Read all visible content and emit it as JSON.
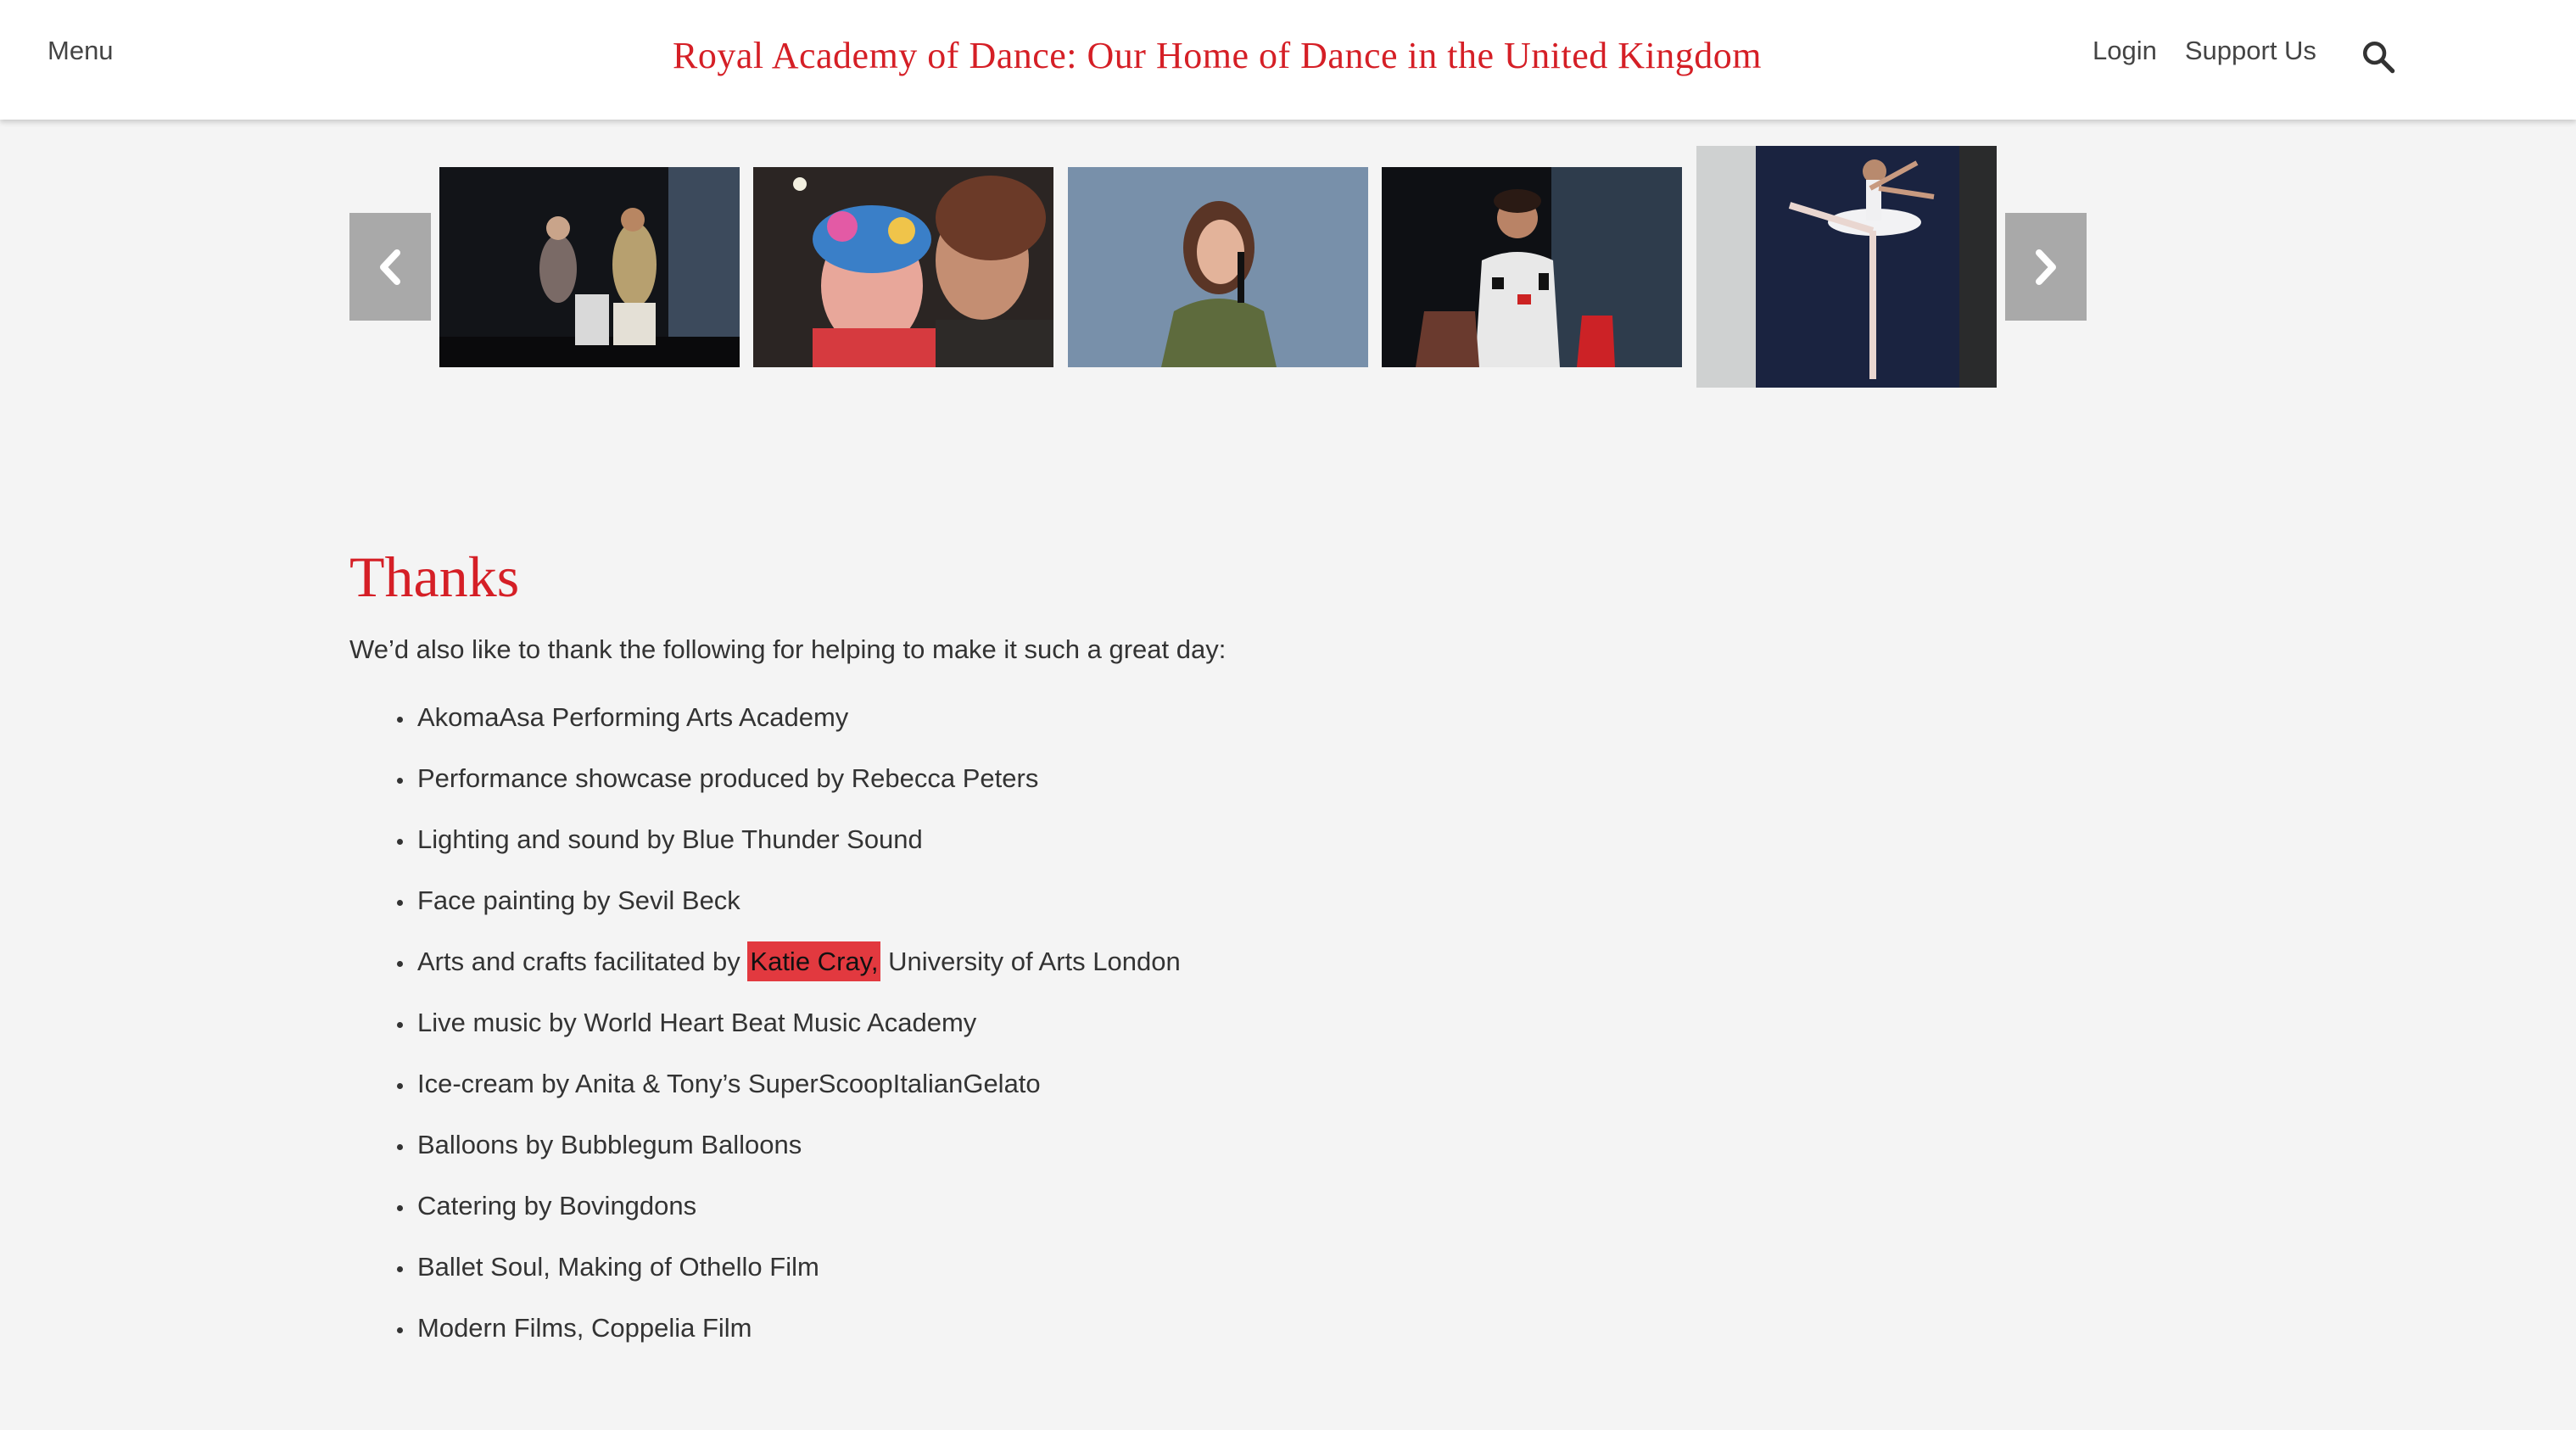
{
  "header": {
    "menu_label": "Menu",
    "title": "Royal Academy of Dance: Our Home of Dance in the United Kingdom",
    "login_label": "Login",
    "support_label": "Support Us",
    "search_icon": "search-icon"
  },
  "gallery": {
    "prev_icon": "chevron-left-icon",
    "next_icon": "chevron-right-icon",
    "thumbnails": [
      {
        "subject": "two people seated on stage"
      },
      {
        "subject": "child with face paint and woman"
      },
      {
        "subject": "woman speaking into microphone"
      },
      {
        "subject": "performer with microphone on stage"
      },
      {
        "subject": "ballerina in white tutu"
      }
    ]
  },
  "content": {
    "heading": "Thanks",
    "intro": "We’d also like to thank the following for helping to make it such a great day:",
    "items": [
      {
        "text": "AkomaAsa Performing Arts Academy"
      },
      {
        "text": "Performance showcase produced by Rebecca Peters"
      },
      {
        "text": "Lighting and sound by Blue Thunder Sound"
      },
      {
        "text": "Face painting by Sevil Beck"
      },
      {
        "prefix": "Arts and crafts facilitated by ",
        "highlight": "Katie Cray,",
        "suffix": " University of Arts London"
      },
      {
        "text": "Live music by World Heart Beat Music Academy"
      },
      {
        "text": "Ice-cream by Anita & Tony’s SuperScoopItalianGelato"
      },
      {
        "text": "Balloons by Bubblegum Balloons"
      },
      {
        "text": "Catering by Bovingdons"
      },
      {
        "text": "Ballet Soul, Making of Othello Film"
      },
      {
        "text": "Modern Films, Coppelia Film"
      }
    ]
  },
  "colors": {
    "brand_red": "#d51f26",
    "highlight_red": "#e2393f",
    "arrow_gray": "#a9a9a9",
    "background": "#f4f4f4"
  }
}
